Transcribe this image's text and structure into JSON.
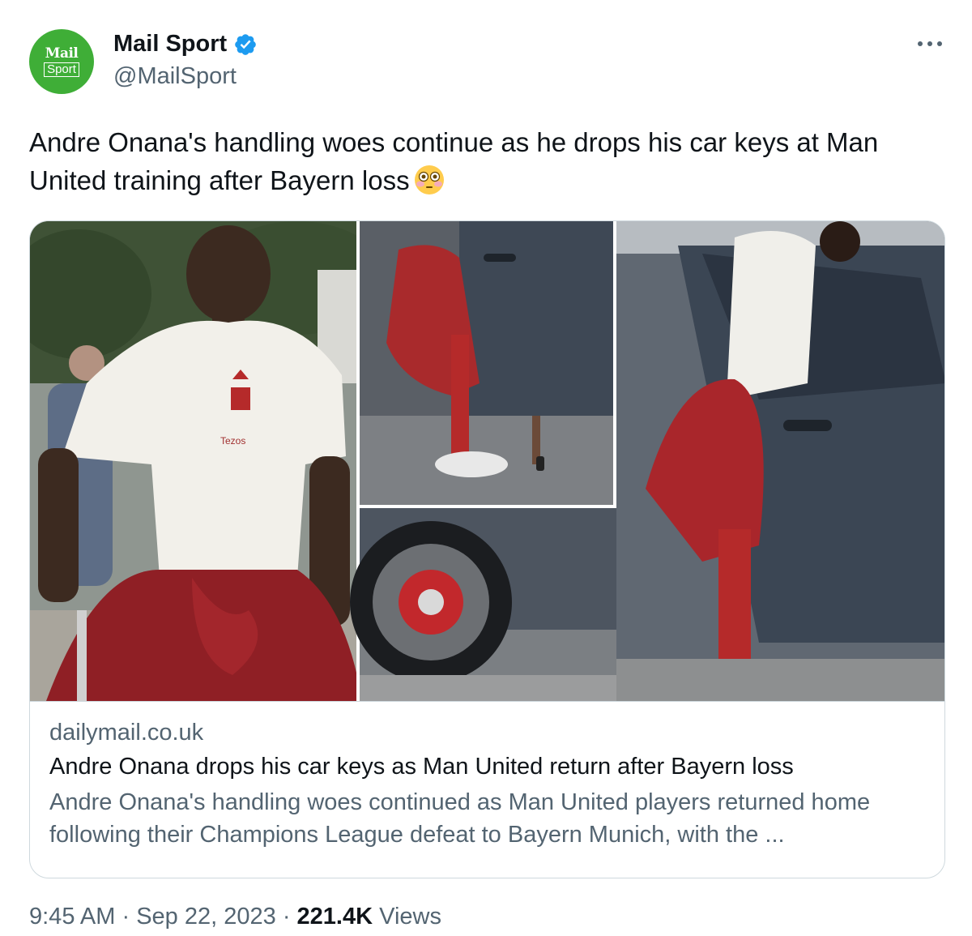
{
  "author": {
    "avatar_logo_top": "Mail",
    "avatar_logo_bottom": "Sport",
    "display_name": "Mail Sport",
    "handle": "@MailSport"
  },
  "tweet": {
    "text": "Andre Onana's handling woes continue as he drops his car keys at Man United training after Bayern loss"
  },
  "card": {
    "domain": "dailymail.co.uk",
    "title": "Andre Onana drops his car keys as Man United return after Bayern loss",
    "description": "Andre Onana's handling woes continued as Man United players returned home following their Champions League defeat to Bayern Munich, with the ...",
    "image_shirt_text": "Tezos"
  },
  "footer": {
    "time": "9:45 AM",
    "separator": "·",
    "date": "Sep 22, 2023",
    "views_count": "221.4K",
    "views_label": "Views"
  },
  "colors": {
    "text_primary": "#0f1419",
    "text_secondary": "#536471",
    "verified_blue": "#1d9bf0",
    "avatar_green": "#3fae37",
    "border": "#cfd9de"
  },
  "icons": [
    "verified-icon",
    "more-icon",
    "flushed-face-emoji"
  ]
}
